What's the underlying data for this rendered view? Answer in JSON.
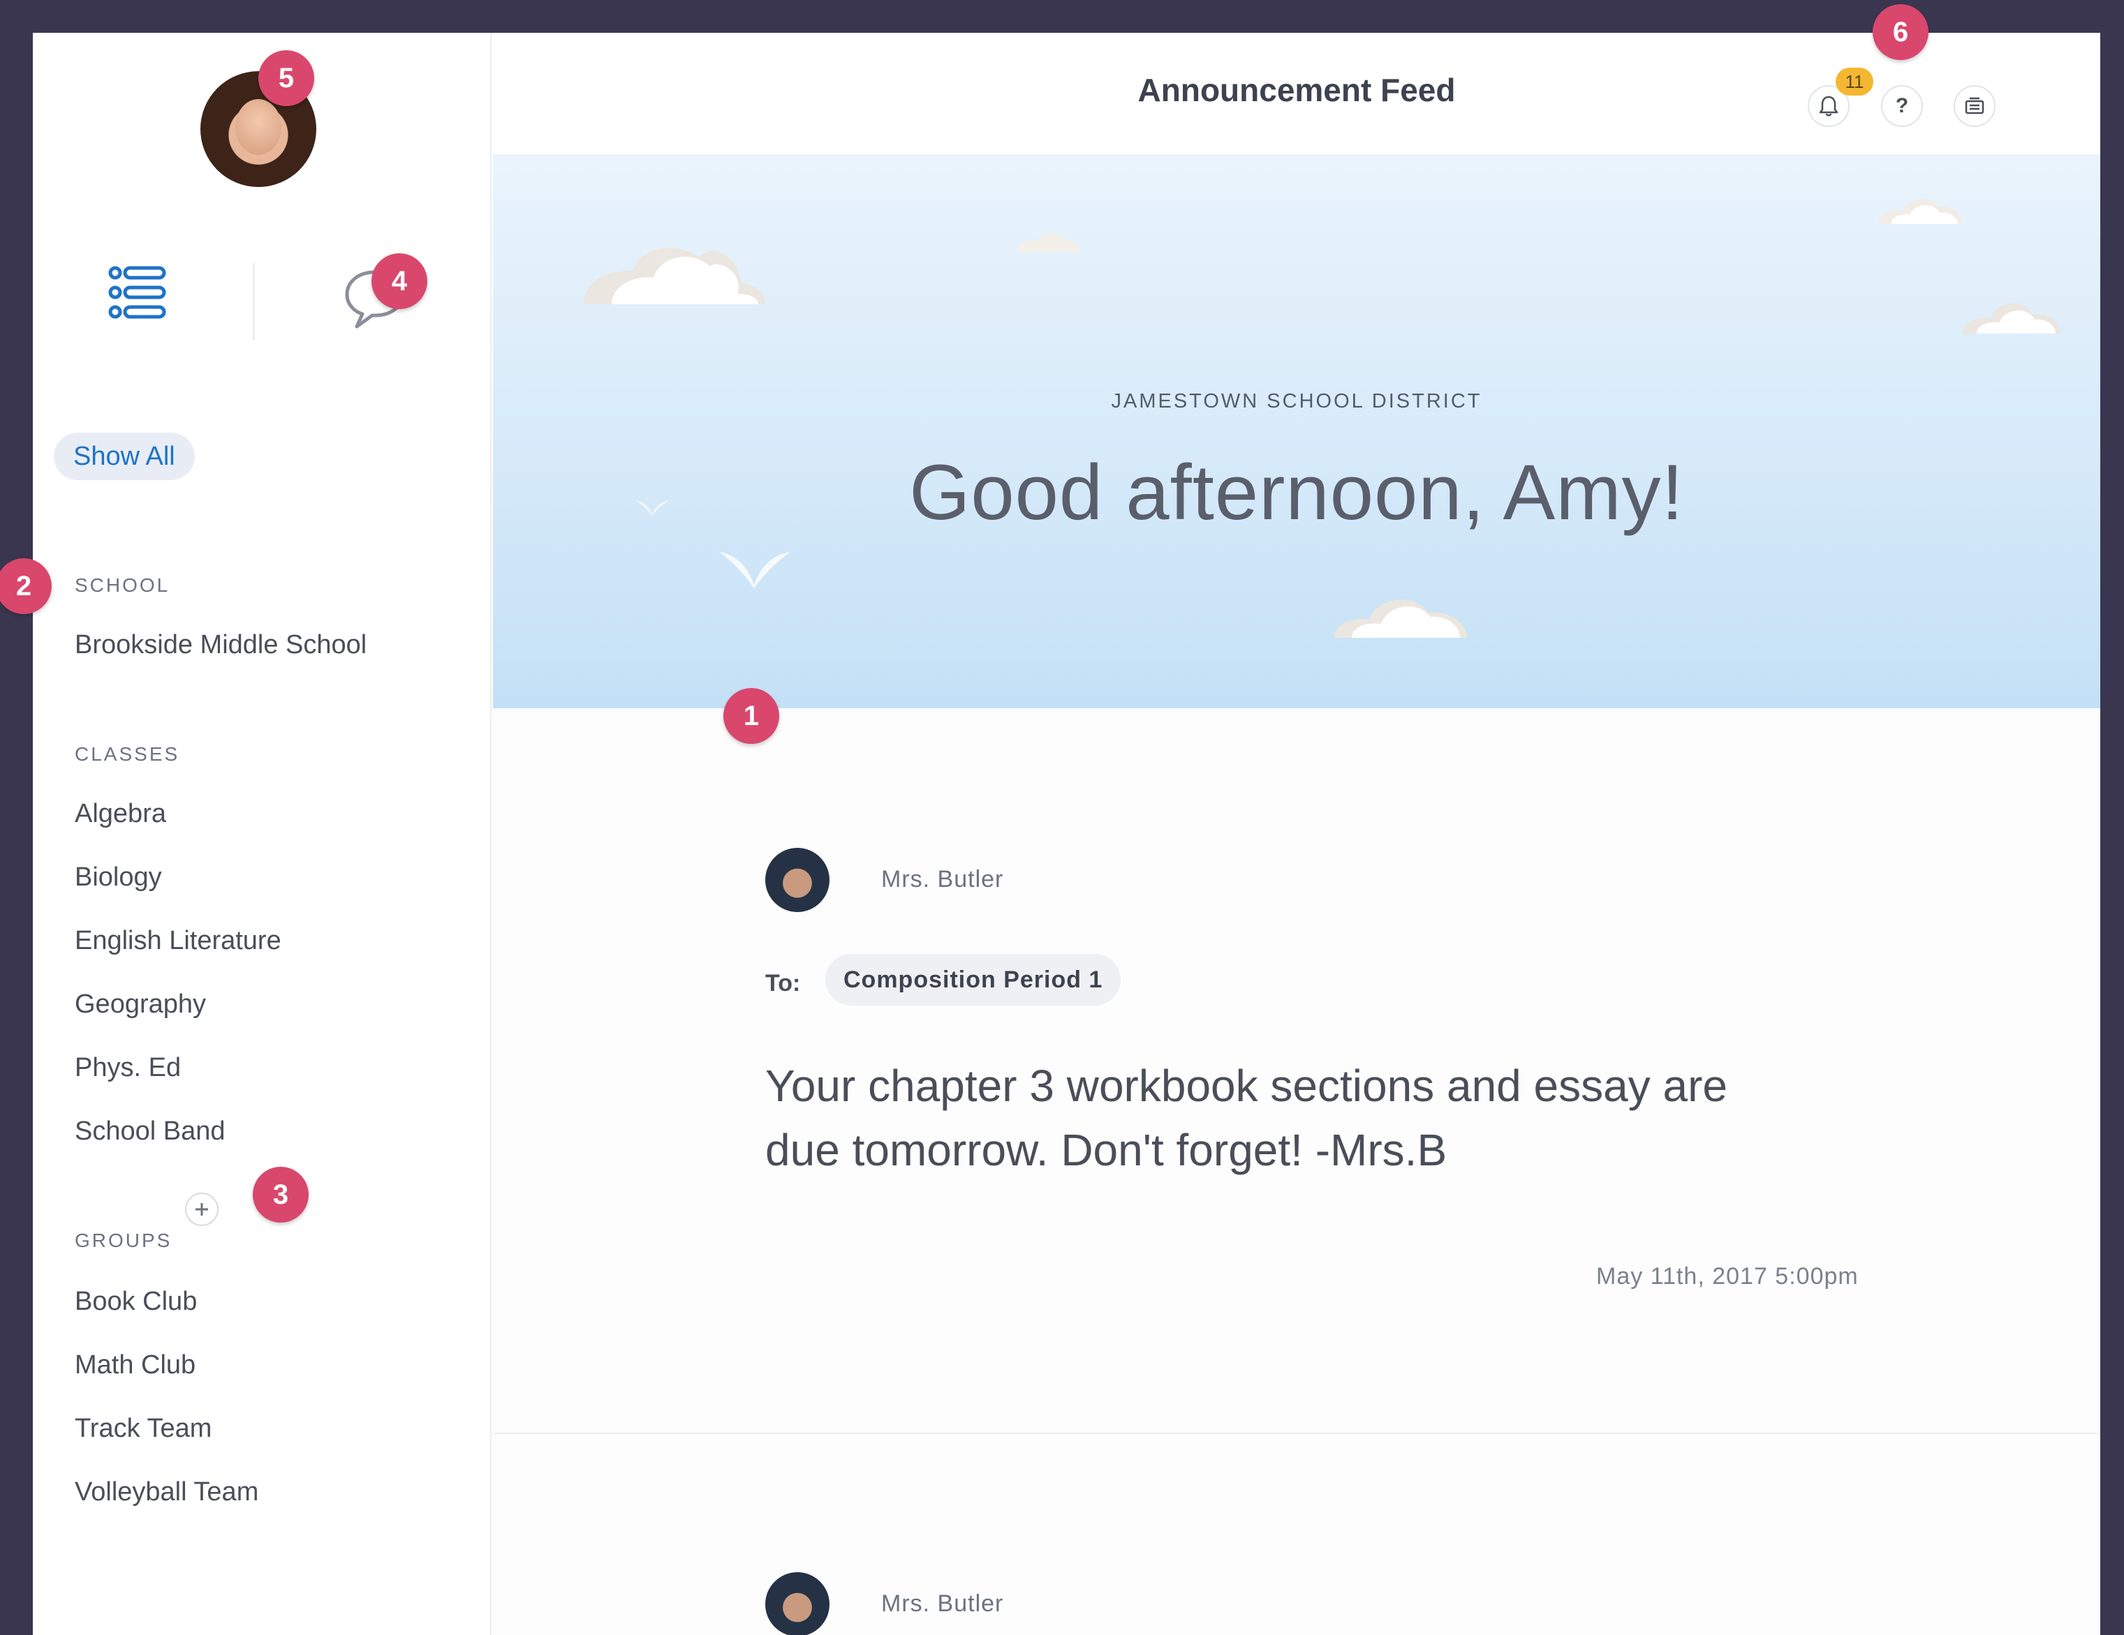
{
  "sidebar": {
    "show_all_label": "Show All",
    "school_title": "SCHOOL",
    "school_name": "Brookside Middle School",
    "classes_title": "CLASSES",
    "classes": [
      "Algebra",
      "Biology",
      "English Literature",
      "Geography",
      "Phys. Ed",
      "School Band"
    ],
    "groups_title": "GROUPS",
    "groups": [
      "Book Club",
      "Math Club",
      "Track Team",
      "Volleyball Team"
    ]
  },
  "header": {
    "title": "Announcement Feed",
    "notification_count": "11",
    "help_label": "?"
  },
  "hero": {
    "district": "JAMESTOWN SCHOOL DISTRICT",
    "greeting": "Good afternoon, Amy!"
  },
  "feed": {
    "posts": [
      {
        "author": "Mrs. Butler",
        "to_label": "To:",
        "recipient": "Composition Period 1",
        "body": "Your chapter 3 workbook sections and essay are due tomorrow. Don't forget! -Mrs.B",
        "timestamp": "May 11th, 2017 5:00pm"
      },
      {
        "author": "Mrs. Butler"
      }
    ]
  },
  "markers": [
    "1",
    "2",
    "3",
    "4",
    "5",
    "6"
  ],
  "colors": {
    "accent": "#1979e6",
    "badge": "#f5b731",
    "marker": "#d9476d",
    "frame": "#3a3650"
  }
}
